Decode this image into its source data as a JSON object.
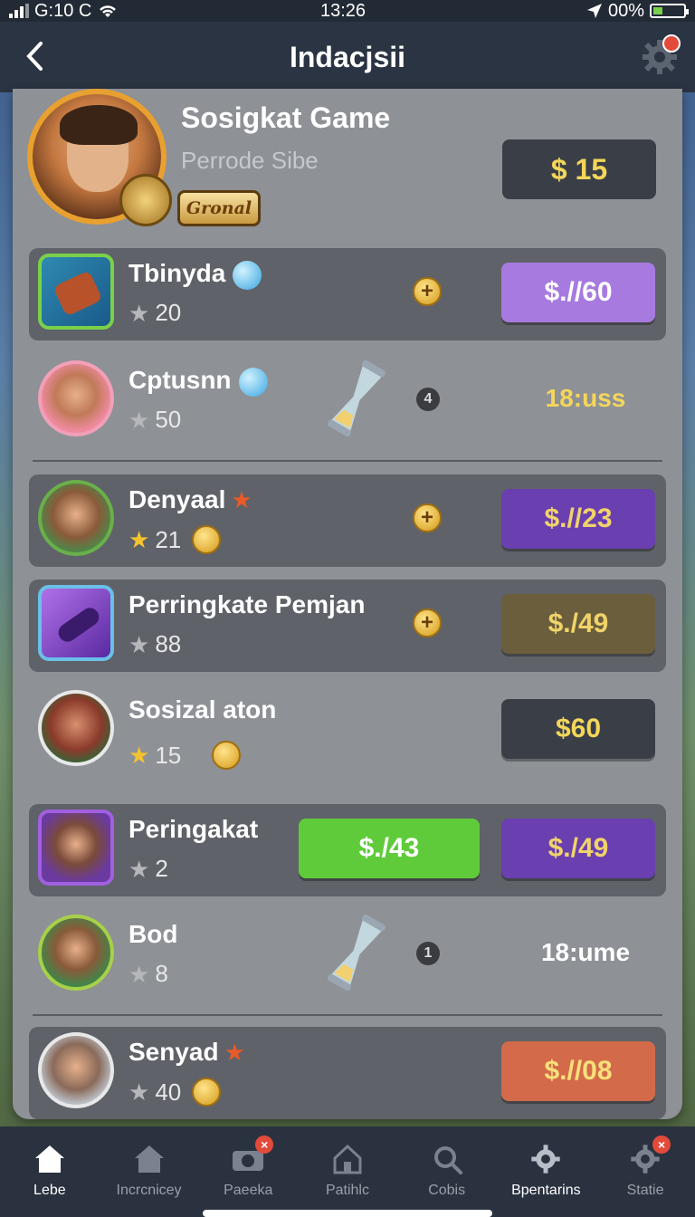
{
  "status_bar": {
    "carrier": "G:10 C",
    "time": "13:26",
    "battery": "00%"
  },
  "header": {
    "title": "Indacjsii"
  },
  "profile": {
    "name": "Sosigkat Game",
    "subtitle": "Perrode Sibe",
    "rank_badge": "Gronal",
    "price": "$ 15"
  },
  "rows": [
    {
      "name": "Tbinyda",
      "stars": "20",
      "price": "$.//60",
      "plus": "+"
    },
    {
      "name": "Cptusnn",
      "stars": "50",
      "timer_count": "4",
      "timer": "18:uss"
    },
    {
      "name": "Denyaal",
      "stars": "21",
      "price": "$.//23",
      "plus": "+"
    },
    {
      "name": "Perringkate Pemjan",
      "stars": "88",
      "price": "$./49",
      "plus": "+"
    },
    {
      "name": "Sosizal aton",
      "stars": "15",
      "price": "$60"
    },
    {
      "name": "Peringakat",
      "stars": "2",
      "price_secondary": "$./43",
      "price": "$./49"
    },
    {
      "name": "Bod",
      "stars": "8",
      "timer_count": "1",
      "timer": "18:ume"
    },
    {
      "name": "Senyad",
      "stars": "40",
      "price": "$.//08"
    }
  ],
  "bottom_nav": [
    {
      "label": "Lebe",
      "icon": "home-icon",
      "active": true
    },
    {
      "label": "Incrcnicey",
      "icon": "house-icon"
    },
    {
      "label": "Paeeka",
      "icon": "camera-icon"
    },
    {
      "label": "Patihlc",
      "icon": "house-outline-icon"
    },
    {
      "label": "Cobis",
      "icon": "search-icon"
    },
    {
      "label": "Bpentarins",
      "icon": "gear-icon"
    },
    {
      "label": "Statie",
      "icon": "gear-badge-icon"
    }
  ],
  "colors": {
    "accent_gold": "#f4d65a",
    "panel": "#8e9196",
    "header": "#2b3442",
    "green": "#5fcb3b",
    "purple": "#6a3fb0"
  }
}
